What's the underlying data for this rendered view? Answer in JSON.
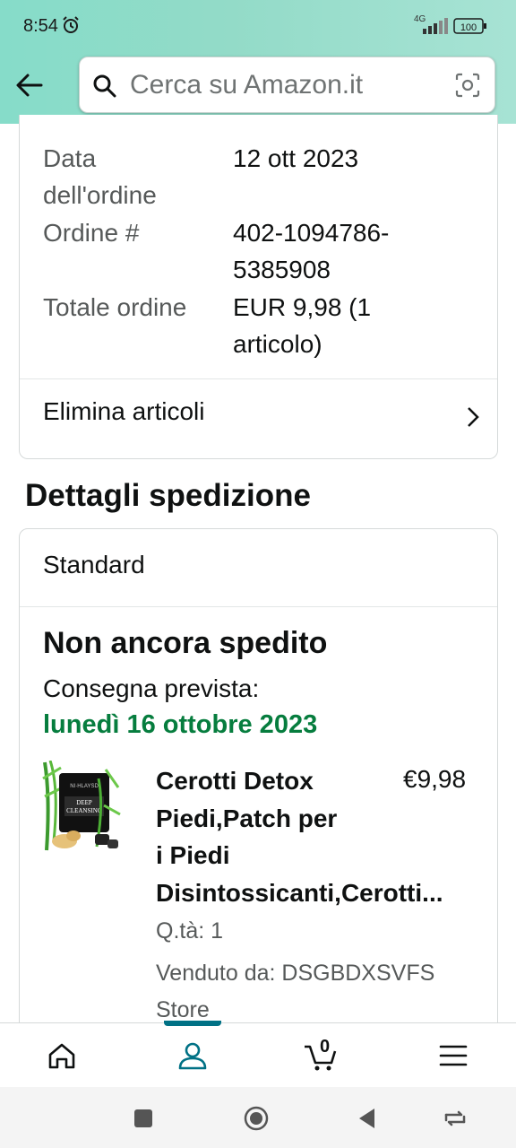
{
  "status_bar": {
    "time": "8:54",
    "network": "4G",
    "battery": "100"
  },
  "search": {
    "placeholder": "Cerca su Amazon.it"
  },
  "order": {
    "rows": [
      {
        "label_lines": [
          "Data",
          "dell'ordine"
        ],
        "value_lines": [
          "12 ott 2023"
        ]
      },
      {
        "label_lines": [
          "Ordine #"
        ],
        "value_lines": [
          "402-1094786-",
          "5385908"
        ]
      },
      {
        "label_lines": [
          "Totale ordine"
        ],
        "value_lines": [
          "EUR 9,98 (1",
          "articolo)"
        ]
      }
    ],
    "remove_items": "Elimina articoli"
  },
  "shipping": {
    "section_title": "Dettagli spedizione",
    "method": "Standard",
    "status": "Non ancora spedito",
    "delivery_label": "Consegna prevista:",
    "delivery_date": "lunedì 16 ottobre 2023",
    "item": {
      "title_lines": [
        "Cerotti Detox",
        "Piedi,Patch per",
        "i Piedi",
        "Disintossicanti,Cerotti..."
      ],
      "price": "€9,98",
      "quantity": "Q.tà: 1",
      "seller_lines": [
        "Venduto da: DSGBDXSVFS",
        "Store"
      ],
      "image_text": [
        "DEEP",
        "CLEANSING"
      ]
    }
  },
  "bottom_nav": {
    "items": [
      "home",
      "account",
      "cart",
      "menu"
    ],
    "cart_count": "0",
    "active": "account"
  },
  "colors": {
    "accent": "#007185",
    "delivery_green": "#067d3e",
    "header_gradient": "#93dbc8"
  }
}
